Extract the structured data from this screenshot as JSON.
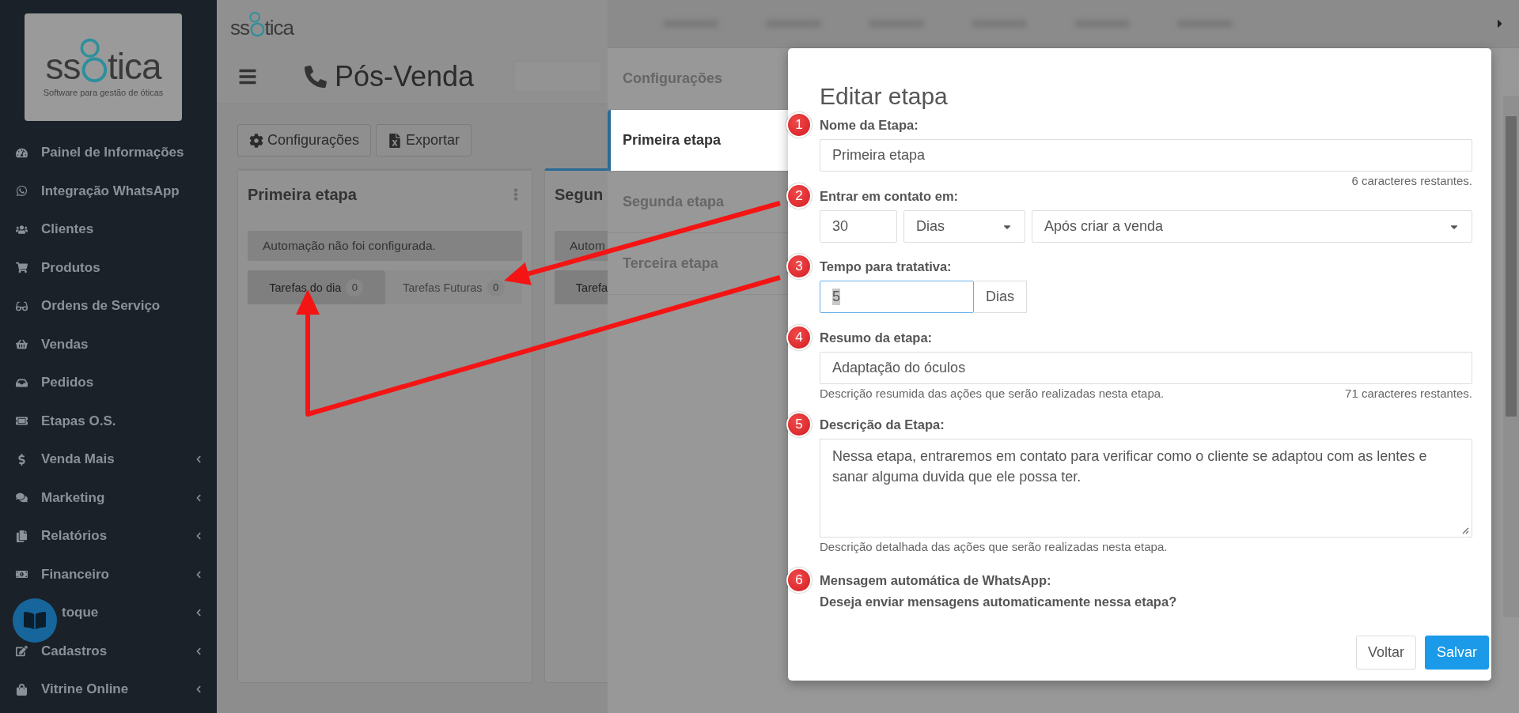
{
  "sidebar": {
    "logo": {
      "prefix": "ss",
      "suffix": "tica",
      "tagline": "Software para gestão de óticas"
    },
    "items": [
      {
        "label": "Painel de Informações",
        "submenu": false,
        "covered": false
      },
      {
        "label": "Integração WhatsApp",
        "submenu": false,
        "covered": false
      },
      {
        "label": "Clientes",
        "submenu": false,
        "covered": false
      },
      {
        "label": "Produtos",
        "submenu": false,
        "covered": false
      },
      {
        "label": "Ordens de Serviço",
        "submenu": false,
        "covered": false
      },
      {
        "label": "Vendas",
        "submenu": false,
        "covered": false
      },
      {
        "label": "Pedidos",
        "submenu": false,
        "covered": false
      },
      {
        "label": "Etapas O.S.",
        "submenu": false,
        "covered": false
      },
      {
        "label": "Venda Mais",
        "submenu": true,
        "covered": false
      },
      {
        "label": "Marketing",
        "submenu": true,
        "covered": false
      },
      {
        "label": "Relatórios",
        "submenu": true,
        "covered": false
      },
      {
        "label": "Financeiro",
        "submenu": true,
        "covered": false
      },
      {
        "label": "toque",
        "submenu": true,
        "covered": true
      },
      {
        "label": "Cadastros",
        "submenu": true,
        "covered": false
      },
      {
        "label": "Vitrine Online",
        "submenu": true,
        "covered": false
      }
    ]
  },
  "header": {
    "logo": {
      "prefix": "ss",
      "suffix": "tica"
    },
    "title": "Pós-Venda"
  },
  "toolbar": [
    "Configurações",
    "Exportar"
  ],
  "cards": [
    {
      "title": "Primeira etapa",
      "highlighted": false,
      "notice": "Automação não foi configurada.",
      "tabs": [
        {
          "label": "Tarefas do dia",
          "count": "0",
          "selected": true
        },
        {
          "label": "Tarefas Futuras",
          "count": "0",
          "selected": false
        }
      ]
    },
    {
      "title": "Segun",
      "highlighted": true,
      "notice": "Autom",
      "tabs": [
        {
          "label": "Tarefa",
          "selected": true
        }
      ]
    }
  ],
  "drawer": {
    "tabs": [
      {
        "label": "Configurações",
        "selected": false
      },
      {
        "label": "Primeira etapa",
        "selected": true
      },
      {
        "label": "Segunda etapa",
        "selected": false
      },
      {
        "label": "Terceira etapa",
        "selected": false
      }
    ]
  },
  "modal": {
    "title": "Editar etapa",
    "fields": [
      {
        "kind": "text",
        "marker": "1",
        "label": "Nome da Etapa:",
        "value": "Primeira etapa",
        "counter": "6 caracteres restantes."
      },
      {
        "kind": "contact",
        "marker": "2",
        "label": "Entrar em contato em:",
        "amount": "30",
        "unit": "Dias",
        "reference": "Após criar a venda"
      },
      {
        "kind": "duration",
        "marker": "3",
        "label": "Tempo para tratativa:",
        "value": "5",
        "unit": "Dias",
        "focused": true
      },
      {
        "kind": "text",
        "marker": "4",
        "label": "Resumo da etapa:",
        "value": "Adaptação do óculos",
        "help": "Descrição resumida das ações que serão realizadas nesta etapa.",
        "counter": "71 caracteres restantes."
      },
      {
        "kind": "textarea",
        "marker": "5",
        "label": "Descrição da Etapa:",
        "value": "Nessa etapa, entraremos em contato para verificar como o cliente se adaptou com as lentes e sanar alguma duvida que ele possa ter.",
        "help": "Descrição detalhada das ações que serão realizadas nesta etapa."
      },
      {
        "kind": "question",
        "marker": "6",
        "label": "Mensagem automática de WhatsApp:",
        "question": "Deseja enviar mensagens automaticamente nessa etapa?"
      }
    ],
    "buttons": [
      {
        "label": "Voltar",
        "kind": "default"
      },
      {
        "label": "Salvar",
        "kind": "primary"
      }
    ]
  }
}
